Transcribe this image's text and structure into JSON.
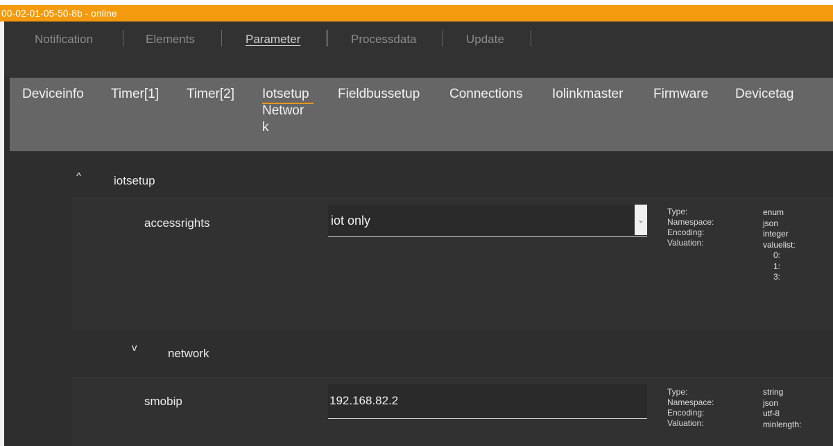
{
  "status": {
    "text": "00-02-01-05-50-8b - online",
    "color": "#f39a0e"
  },
  "main_tabs": [
    {
      "label": "Notification",
      "active": false
    },
    {
      "label": "Elements",
      "active": false
    },
    {
      "label": "Parameter",
      "active": true
    },
    {
      "label": "Processdata",
      "active": false
    },
    {
      "label": "Update",
      "active": false
    }
  ],
  "sub_tabs": [
    {
      "label": "Deviceinfo"
    },
    {
      "label": "Timer[1]"
    },
    {
      "label": "Timer[2]"
    },
    {
      "label": "Iotsetup",
      "active": true,
      "line2": "Networ",
      "line3": "k"
    },
    {
      "label": "Fieldbussetup"
    },
    {
      "label": "Connections"
    },
    {
      "label": "Iolinkmaster"
    },
    {
      "label": "Firmware"
    },
    {
      "label": "Devicetag"
    }
  ],
  "sections": {
    "iotsetup": {
      "chevron": "^",
      "label": "iotsetup"
    },
    "network": {
      "chevron": "v",
      "label": "network"
    }
  },
  "params": {
    "accessrights": {
      "name": "accessrights",
      "value": "iot only",
      "meta_labels": [
        "Type:",
        "Namespace:",
        "Encoding:",
        "Valuation:"
      ],
      "meta_values": [
        "enum",
        "json",
        "integer",
        "valuelist:",
        "0:",
        "1:",
        "3:"
      ]
    },
    "smobip": {
      "name": "smobip",
      "value": "192.168.82.2",
      "meta_labels": [
        "Type:",
        "Namespace:",
        "Encoding:",
        "Valuation:"
      ],
      "meta_values": [
        "string",
        "json",
        "utf-8",
        "minlength:"
      ]
    }
  },
  "icons": {
    "select_arrow": "chevron-down-icon"
  }
}
